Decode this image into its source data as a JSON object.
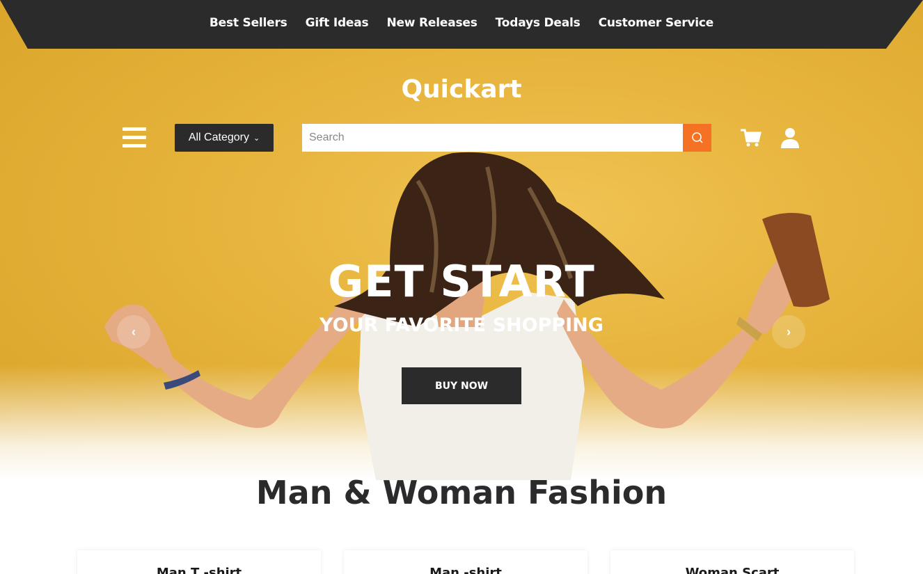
{
  "nav": {
    "links": [
      "Best Sellers",
      "Gift Ideas",
      "New Releases",
      "Todays Deals",
      "Customer Service"
    ]
  },
  "header": {
    "brand": "Quickart",
    "menu_icon": "hamburger-icon",
    "category_label": "All Category",
    "category_chevron": "⌄",
    "search": {
      "placeholder": "Search",
      "value": "",
      "icon": "search-icon"
    },
    "cart_icon": "cart-icon",
    "user_icon": "user-icon"
  },
  "hero": {
    "headline": "GET START",
    "subline": "YOUR FAVORITE SHOPPING",
    "button_label": "BUY NOW",
    "prev_arrow": "‹",
    "next_arrow": "›"
  },
  "section": {
    "title": "Man & Woman Fashion",
    "cards": [
      "Man T -shirt",
      "Man -shirt",
      "Woman Scart"
    ]
  },
  "colors": {
    "dark": "#2b2b2b",
    "accent": "#f57224",
    "hero_bg": "#e6b33b"
  }
}
